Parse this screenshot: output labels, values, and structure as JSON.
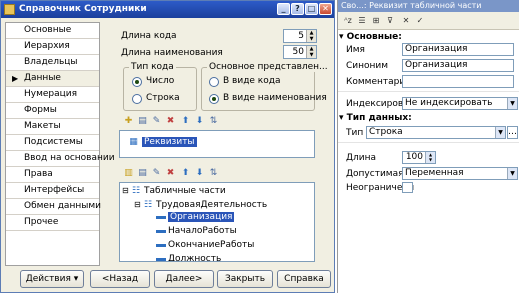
{
  "window": {
    "title": "Справочник Сотрудники",
    "controls": {
      "minimize": "_",
      "help": "?",
      "maximize": "□",
      "close": "✕"
    }
  },
  "nav": {
    "items": [
      {
        "label": "Основные"
      },
      {
        "label": "Иерархия"
      },
      {
        "label": "Владельцы"
      },
      {
        "label": "Данные",
        "selected": true
      },
      {
        "label": "Нумерация"
      },
      {
        "label": "Формы"
      },
      {
        "label": "Макеты"
      },
      {
        "label": "Подсистемы"
      },
      {
        "label": "Ввод на основании"
      },
      {
        "label": "Права"
      },
      {
        "label": "Интерфейсы"
      },
      {
        "label": "Обмен данными"
      },
      {
        "label": "Прочее"
      }
    ]
  },
  "main": {
    "code_length_label": "Длина кода",
    "code_length_value": "5",
    "name_length_label": "Длина наименования",
    "name_length_value": "50",
    "code_type": {
      "label": "Тип кода",
      "options": [
        {
          "label": "Число",
          "checked": true
        },
        {
          "label": "Строка",
          "checked": false
        }
      ]
    },
    "main_repr": {
      "label": "Основное представлен...",
      "options": [
        {
          "label": "В виде кода",
          "checked": false
        },
        {
          "label": "В виде наименования",
          "checked": true
        }
      ]
    },
    "attributes": {
      "items": [
        "Реквизиты"
      ]
    },
    "tabular": {
      "root": "Табличные части",
      "part": "ТрудоваяДеятельность",
      "fields": [
        "Организация",
        "НачалоРаботы",
        "ОкончаниеРаботы",
        "Должность"
      ]
    }
  },
  "buttons": {
    "actions": "Действия",
    "back": "<Назад",
    "next": "Далее>",
    "close": "Закрыть",
    "help": "Справка"
  },
  "props": {
    "title": "Сво...: Реквизит табличной части",
    "sections": {
      "main": "Основные:",
      "datatype": "Тип данных:"
    },
    "fields": {
      "name_label": "Имя",
      "name_value": "Организация",
      "synonym_label": "Синоним",
      "synonym_value": "Организация",
      "comment_label": "Комментарий",
      "comment_value": "",
      "index_label": "Индексироват",
      "index_value": "Не индексировать",
      "type_label": "Тип",
      "type_value": "Строка",
      "length_label": "Длина",
      "length_value": "100",
      "allowed_label": "Допустимая д",
      "allowed_value": "Переменная",
      "unlimited_label": "Неограниченн"
    }
  },
  "colors": {
    "title_bar": "#1b3f9c",
    "selection": "#2a55b8",
    "panel_bg": "#f1efe2"
  }
}
